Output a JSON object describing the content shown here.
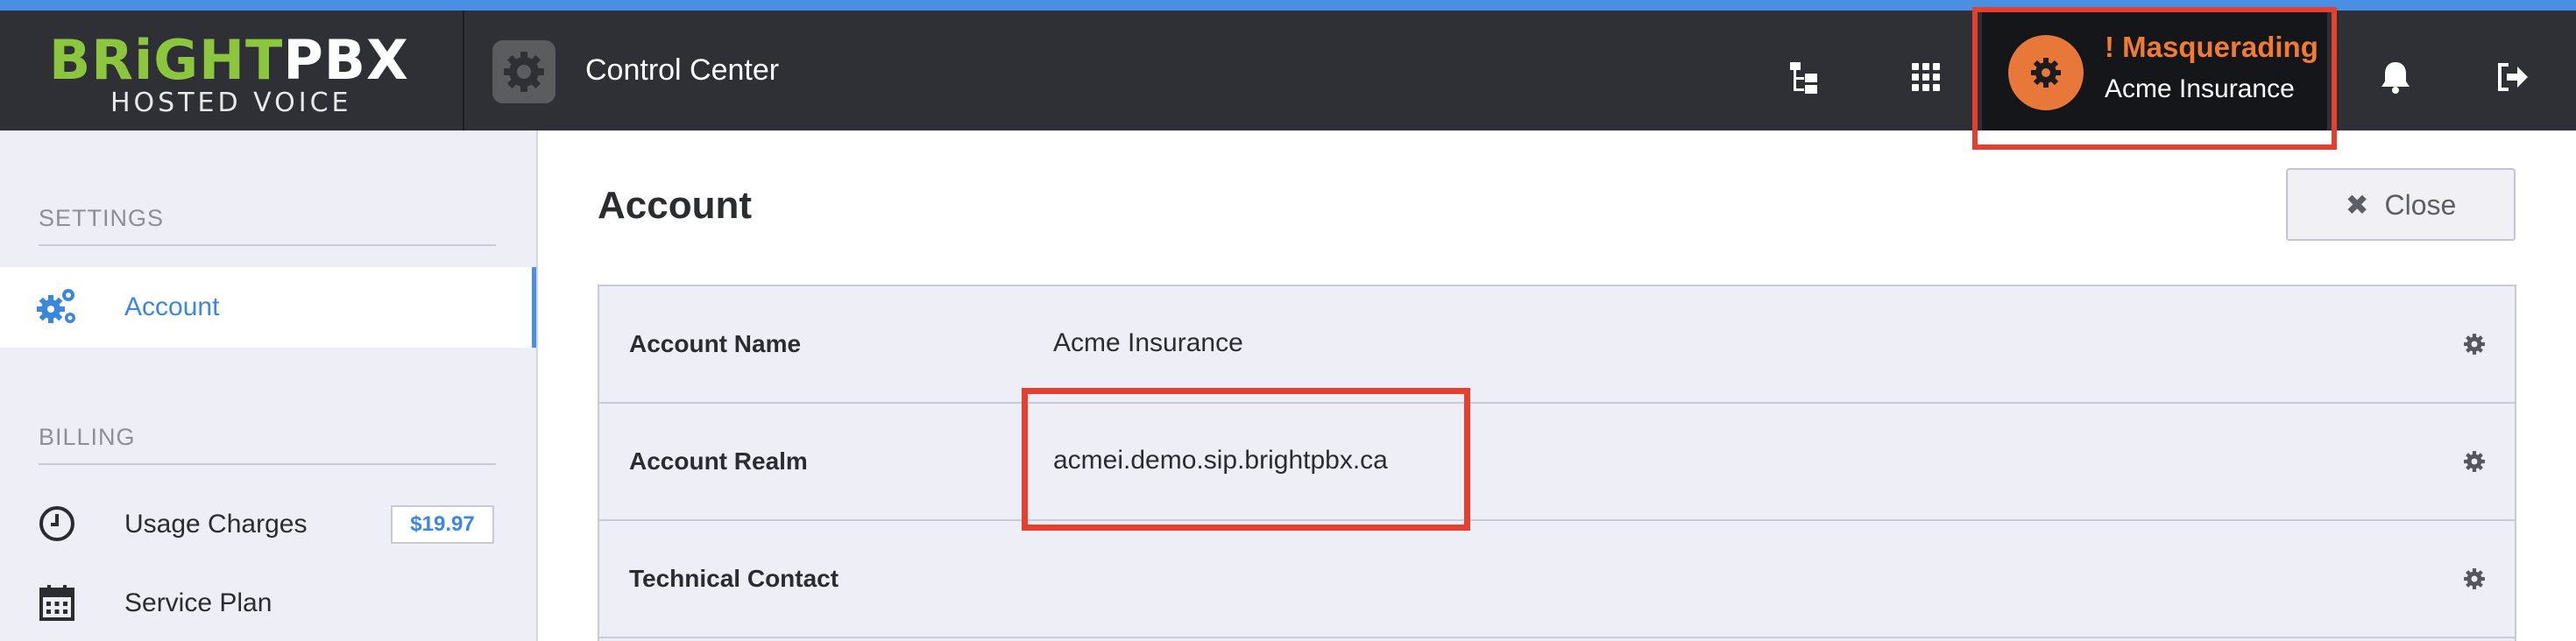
{
  "brand": {
    "logo_green": "BRiGHT",
    "logo_white": "PBX",
    "tagline": "HOSTED VOICE"
  },
  "header": {
    "app_title": "Control Center",
    "masquerade": {
      "title": "! Masquerading",
      "account": "Acme Insurance"
    }
  },
  "sidebar": {
    "settings": {
      "heading": "SETTINGS",
      "items": [
        {
          "label": "Account",
          "icon": "gears-icon",
          "active": true
        }
      ]
    },
    "billing": {
      "heading": "BILLING",
      "items": [
        {
          "label": "Usage Charges",
          "icon": "clock-icon",
          "badge": "$19.97"
        },
        {
          "label": "Service Plan",
          "icon": "calendar-icon"
        }
      ]
    }
  },
  "main": {
    "title": "Account",
    "close_label": "Close",
    "rows": [
      {
        "key": "Account Name",
        "value": "Acme Insurance"
      },
      {
        "key": "Account Realm",
        "value": "acmei.demo.sip.brightpbx.ca"
      },
      {
        "key": "Technical Contact",
        "value": ""
      }
    ]
  },
  "colors": {
    "accent_blue": "#4a8fe3",
    "masquerade_orange": "#e8773a",
    "highlight_red": "#e5402f",
    "brand_green": "#8cc63f",
    "topbar": "#2f3035"
  }
}
